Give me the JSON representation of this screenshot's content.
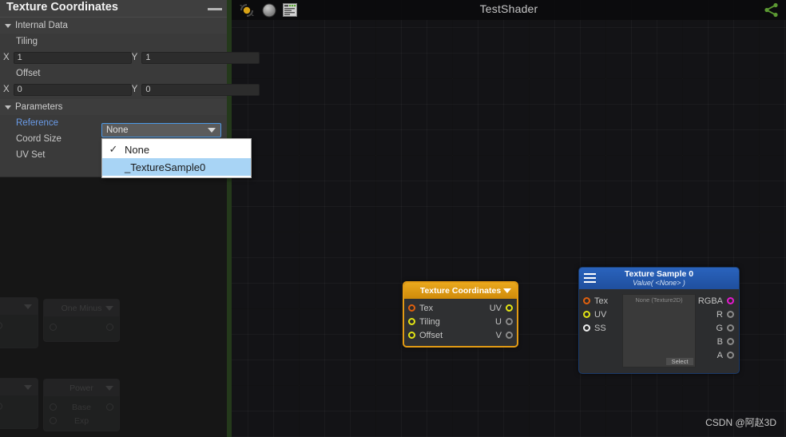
{
  "app": {
    "shader_title": "TestShader",
    "watermark": "CSDN @阿赵3D"
  },
  "toolbar": {
    "icons": [
      {
        "name": "update-icon",
        "label": "update"
      },
      {
        "name": "sphere-preview-icon",
        "label": "preview"
      },
      {
        "name": "shader-code-icon",
        "label": "code"
      }
    ],
    "share_icon": "share-icon"
  },
  "panel": {
    "title": "Texture Coordinates",
    "minimize_label": "minimize",
    "sections": {
      "internal_data": {
        "header": "Internal Data",
        "groups": [
          {
            "label": "Tiling",
            "fields": [
              {
                "axis": "X",
                "value": "1"
              },
              {
                "axis": "Y",
                "value": "1"
              }
            ]
          },
          {
            "label": "Offset",
            "fields": [
              {
                "axis": "X",
                "value": "0"
              },
              {
                "axis": "Y",
                "value": "0"
              }
            ]
          }
        ]
      },
      "parameters": {
        "header": "Parameters",
        "rows": [
          {
            "label": "Reference",
            "highlight": true
          },
          {
            "label": "Coord Size",
            "highlight": false
          },
          {
            "label": "UV Set",
            "highlight": false
          }
        ]
      }
    },
    "dropdown": {
      "name": "reference-dropdown",
      "value": "None",
      "options": [
        {
          "label": "None",
          "checked": true,
          "selected": false
        },
        {
          "label": "_TextureSample0",
          "checked": false,
          "selected": true
        }
      ]
    }
  },
  "ghost_nodes": [
    {
      "title": "One Minus",
      "rows": [
        {
          "in": "",
          "out": ""
        }
      ]
    },
    {
      "title": "Power",
      "rows": [
        {
          "in": "Base",
          "out": ""
        },
        {
          "in": "Exp",
          "out": ""
        }
      ]
    }
  ],
  "nodes": {
    "texture_coordinates": {
      "title": "Texture Coordinates",
      "rows": [
        {
          "in_label": "Tex",
          "in_color": "orange",
          "out_label": "UV",
          "out_color": "yellow"
        },
        {
          "in_label": "Tiling",
          "in_color": "yellow",
          "out_label": "U",
          "out_color": "grey"
        },
        {
          "in_label": "Offset",
          "in_color": "yellow",
          "out_label": "V",
          "out_color": "grey"
        }
      ]
    },
    "texture_sample": {
      "title": "Texture Sample 0",
      "subtitle": "Value( <None> )",
      "inputs": [
        {
          "label": "Tex",
          "color": "orange"
        },
        {
          "label": "UV",
          "color": "yellow"
        },
        {
          "label": "SS",
          "color": "white"
        }
      ],
      "outputs": [
        {
          "label": "RGBA",
          "color": "magenta"
        },
        {
          "label": "R",
          "color": "grey"
        },
        {
          "label": "G",
          "color": "grey"
        },
        {
          "label": "B",
          "color": "grey"
        },
        {
          "label": "A",
          "color": "grey"
        }
      ],
      "preview_label": "None (Texture2D)",
      "select_button": "Select"
    }
  },
  "colors": {
    "accent_orange": "#e39b14",
    "accent_blue": "#2a63bd",
    "panel_bg": "#3a3a3a",
    "canvas_bg": "#131316",
    "green_strip": "#3b7a22",
    "dropdown_border": "#4c9ae8",
    "menu_selected": "#a8d4f5",
    "reference_label": "#6a9be8"
  }
}
